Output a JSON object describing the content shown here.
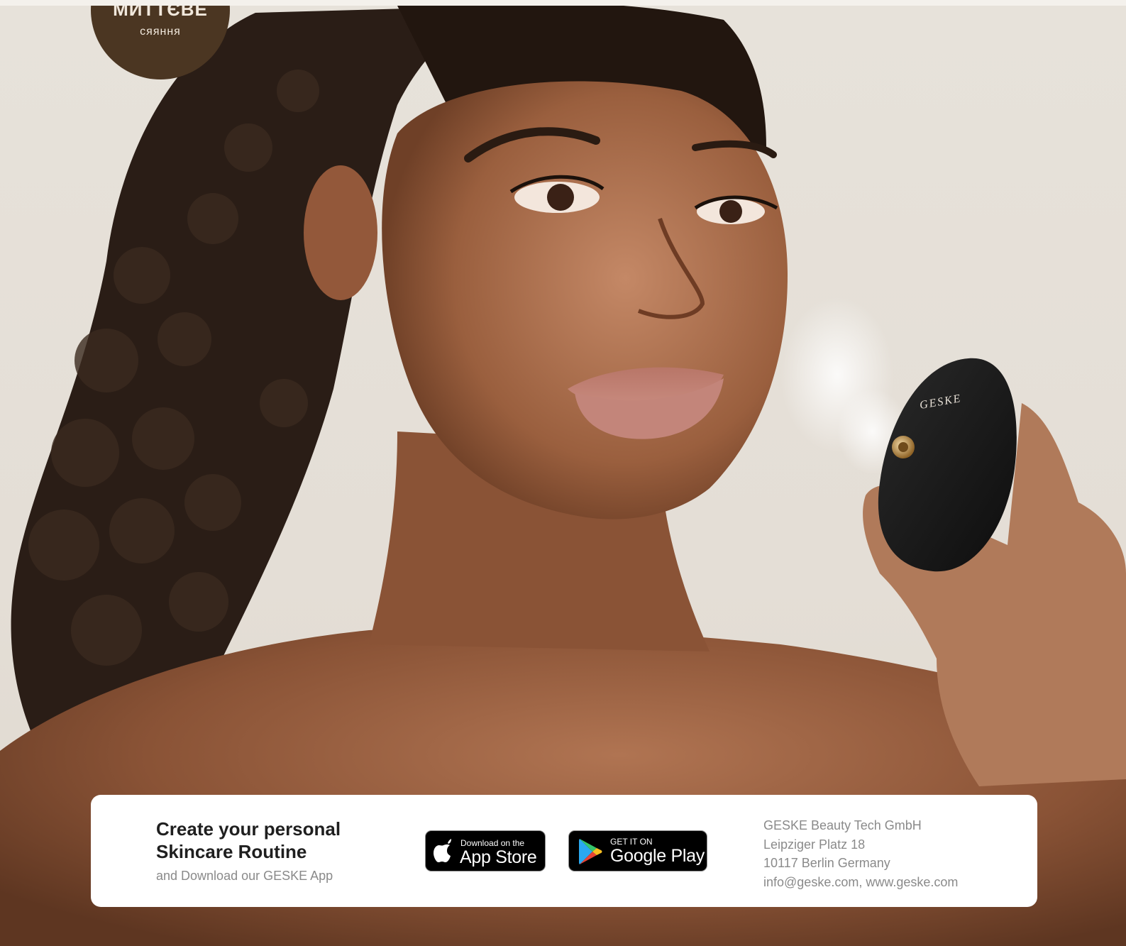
{
  "badge": {
    "title": "МИТТЄВЕ",
    "subtitle": "сяяння"
  },
  "hero": {
    "device_brand": "GESKE",
    "photo_description_icon": "woman-portrait-image",
    "device_icon": "facial-device-image"
  },
  "promo": {
    "title": "Create your personal Skincare Routine",
    "subtitle": "and Download our GESKE App"
  },
  "app_store": {
    "small": "Download on the",
    "big": "App Store",
    "icon": "apple-logo-icon"
  },
  "google_play": {
    "small": "GET IT ON",
    "big": "Google Play",
    "icon": "google-play-icon"
  },
  "company": {
    "name": "GESKE Beauty Tech GmbH",
    "street": "Leipziger Platz 18",
    "city": "10117 Berlin Germany",
    "contact": "info@geske.com, www.geske.com"
  },
  "colors": {
    "background": "#e7e2da",
    "badge": "#4b3622",
    "card": "#ffffff",
    "text_dark": "#1f1f1f",
    "text_muted": "#8a8a8a"
  }
}
